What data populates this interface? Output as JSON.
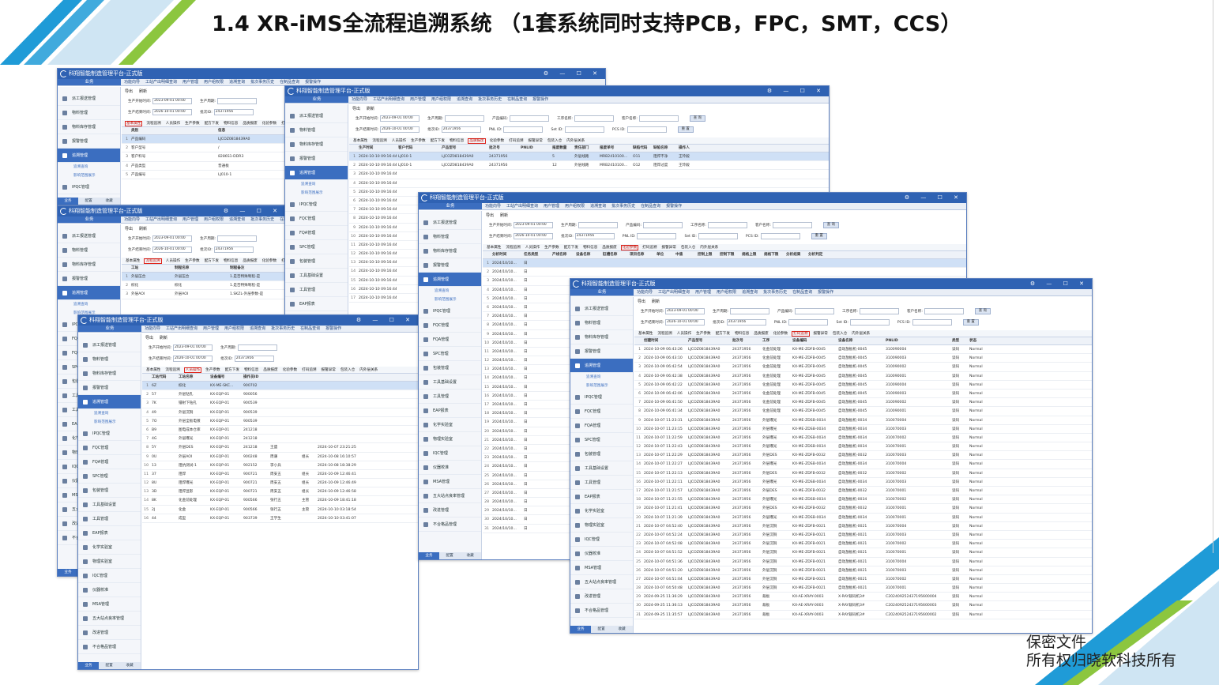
{
  "slide": {
    "title": "1.4 XR-iMS全流程追溯系统 （1套系统同时支持PCB，FPC，SMT，CCS）",
    "watermark_line1": "保密文件",
    "watermark_line2": "所有权归晓软科技所有"
  },
  "colors": {
    "accent": "#2f62b3",
    "highlight": "#e0241a",
    "deco_blue": "#1f9bd7",
    "deco_green": "#8cc63f"
  },
  "app": {
    "window_title": "科翔智能制造管理平台-正式版",
    "biz_label": "业务",
    "window_controls": "⚙ — ☐ ✕",
    "toolbar_export": "导出",
    "toolbar_refresh": "刷新",
    "top_tabs_a": [
      "功能向导",
      "工站产出明细查询",
      "用户管理",
      "用户组权限",
      "追溯查询",
      "批次事务历史",
      "在制品查询",
      "报警操作"
    ],
    "sidebar_items": [
      "派工报送管理",
      "物料管理",
      "物料库存管理",
      "报警管理",
      "追溯管理",
      "IPQC管理",
      "FQC管理",
      "FQA管理",
      "SPC管理",
      "包装管理",
      "工具基础设置",
      "工具管理",
      "EAP报表",
      "化学实验室",
      "物理实验室",
      "IQC管理",
      "仪器校准",
      "MSA管理",
      "五大站点良率管理",
      "改进管理",
      "不合格品管理"
    ],
    "sidebar_sub": [
      "追溯查询",
      "影响范围展示"
    ],
    "sidebar_foot": [
      "业务",
      "配置",
      "收藏"
    ],
    "filters": {
      "start_label": "生产开始时间:",
      "start_value": "2023-09-01 00:00",
      "end_label": "生产结束时间:",
      "end_value": "2026-10-01 00:00",
      "cycle_label": "生产周期:",
      "batch_label": "批次ID:",
      "batch_value": "24371956",
      "product_label": "产品编码:",
      "pnl_label": "PNL ID:",
      "proc_label": "工序名称:",
      "set_label": "Set ID:",
      "customer_label": "客户名称:",
      "pcs_label": "PCS ID:",
      "query_btn": "查 询",
      "reset_btn": "重 置"
    },
    "subtabs": [
      "基本属性",
      "流程追溯",
      "人员操作",
      "生产参数",
      "配方下发",
      "物料信息",
      "品质报废",
      "化验参数",
      "打码追溯",
      "报警异常",
      "包装入仓",
      "内外层关系"
    ]
  },
  "windows": {
    "w1": {
      "highlight": "基本属性",
      "headers": [
        "类别",
        "信息"
      ],
      "rows": [
        [
          "产品编码",
          "LJCOZ0818439A0"
        ],
        [
          "客户型号",
          "/"
        ],
        [
          "客户料号",
          "8286S1-DDR3"
        ],
        [
          "产品类型",
          "普通板"
        ],
        [
          "产品编号",
          "LJ010-1"
        ]
      ]
    },
    "w2": {
      "highlight": "流程追溯",
      "headers": [
        "工站",
        "制程名称",
        "制程备注"
      ],
      "rows": [
        [
          "外层压合",
          "外层压合",
          "1.是否特殊制程-是"
        ],
        [
          "棕化",
          "棕化",
          "1.是否特殊制程-是"
        ],
        [
          "外层AOI",
          "外层AOI",
          "1.SKZL-外层参数-是"
        ]
      ]
    },
    "w3": {
      "highlight": "人员操作",
      "headers": [
        "工站代码",
        "工站名称",
        "设备编号",
        "操作员ID"
      ],
      "rows": [
        [
          "6Z",
          "棕化",
          "KX-ME-SKC...",
          "900702"
        ],
        [
          "57",
          "外层钻孔",
          "KX-EQP-01",
          "900056"
        ],
        [
          "7K",
          "镭射下钻孔",
          "KX-EQP-01",
          "900539"
        ],
        [
          "49",
          "外层沉铜",
          "KX-EQP-01",
          "900539"
        ],
        [
          "7O",
          "外层全板电镀",
          "KX-EQP-01",
          "900539"
        ],
        [
          "B9",
          "图电成本仓库",
          "KX-EQP-01",
          "241218"
        ],
        [
          "4G",
          "外层曝光",
          "KX-EQP-01",
          "241218"
        ],
        [
          "5Y",
          "外层DES",
          "KX-EQP-01",
          "241218"
        ],
        [
          "0U",
          "外层AOI",
          "KX-EQP-01",
          "900248"
        ],
        [
          "13",
          "阻抗测试-1",
          "KX-EQP-01",
          "902152"
        ],
        [
          "37",
          "阻焊",
          "KX-EQP-01",
          "900721"
        ],
        [
          "8U",
          "阻焊曝光",
          "KX-EQP-01",
          "900721"
        ],
        [
          "3D",
          "阻焊显影",
          "KX-EQP-01",
          "900721"
        ],
        [
          "8K",
          "化金前处理",
          "KX-EQP-01",
          "900566"
        ],
        [
          "2J",
          "化金",
          "KX-EQP-01",
          "900566"
        ],
        [
          "44",
          "成型",
          "KX-EQP-01",
          "903739"
        ]
      ],
      "extra_rows": [
        [
          "王盛",
          "",
          "2024-10-07 23:21:25"
        ],
        [
          "周谦",
          "组长",
          "2024-10-08 16:10:57"
        ],
        [
          "李小兵",
          "",
          "2024-10-08 18:38:29"
        ],
        [
          "周安五",
          "组长",
          "2024-10-09 12:46:41"
        ],
        [
          "周安五",
          "组长",
          "2024-10-09 12:46:49"
        ],
        [
          "周安五",
          "组长",
          "2024-10-09 12:46:58"
        ],
        [
          "张行五",
          "主管",
          "2024-10-09 18:41:18"
        ],
        [
          "张行五",
          "主管",
          "2024-10-10 03:18:54"
        ],
        [
          "王学生",
          "",
          "2024-10-10 03:41:07"
        ]
      ]
    },
    "w4": {
      "highlight": "品质报废",
      "headers": [
        "生产时间",
        "客户代码",
        "产品型号",
        "批次号",
        "PNLID",
        "报废数量",
        "责任部门",
        "报废单号",
        "缺陷代码",
        "缺陷名称",
        "操作人"
      ],
      "rows": [
        [
          "2024-10-10 09:16:44",
          "LJ010-1",
          "LJCOZ0818439A0",
          "24371956",
          "",
          "5",
          "外层线路",
          "MRB2410100...",
          "O11",
          "阻焊不净",
          "王玲毅"
        ],
        [
          "2024-10-10 09:16:44",
          "LJ010-1",
          "LJCOZ0818439A0",
          "24371956",
          "",
          "12",
          "外层线路",
          "MRB2410100...",
          "O12",
          "阻焊过度",
          "王玲毅"
        ]
      ],
      "time_rows": 17,
      "time_value": "2024-10-10 09:16:44"
    },
    "w5": {
      "highlight": "化验参数",
      "headers": [
        "分析时间",
        "任务类型",
        "产线名称",
        "设备名称",
        "缸槽名称",
        "项目名称",
        "单位",
        "中值",
        "控制上限",
        "控制下限",
        "规格上限",
        "规格下限",
        "分析结果",
        "分析判定"
      ],
      "time_value": "2024/10/10...",
      "type_value": "日",
      "rows": 31
    },
    "w6": {
      "highlight": "打码追溯",
      "headers": [
        "创建时间",
        "产品型号",
        "批次号",
        "工序",
        "设备编码",
        "设备名称",
        "PNLID",
        "类型",
        "状态"
      ],
      "rows": [
        [
          "2024-10-09 06:43:26",
          "LJCOZ0818439A0",
          "24371956",
          "化金前处理",
          "KX-ME-ZDFB-0045",
          "自动放板机-0045",
          "310090004",
          "读码",
          "Normal"
        ],
        [
          "2024-10-09 06:43:10",
          "LJCOZ0818439A0",
          "24371956",
          "化金前处理",
          "KX-ME-ZDFB-0045",
          "自动放板机-0045",
          "310090003",
          "读码",
          "Normal"
        ],
        [
          "2024-10-09 06:42:54",
          "LJCOZ0818439A0",
          "24371956",
          "化金前处理",
          "KX-ME-ZDFB-0045",
          "自动放板机-0045",
          "310090002",
          "读码",
          "Normal"
        ],
        [
          "2024-10-09 06:42:38",
          "LJCOZ0818439A0",
          "24371956",
          "化金前处理",
          "KX-ME-ZDFB-0045",
          "自动放板机-0045",
          "310090001",
          "读码",
          "Normal"
        ],
        [
          "2024-10-09 06:42:22",
          "LJCOZ0818439A0",
          "24371956",
          "化金前处理",
          "KX-ME-ZDFB-0045",
          "自动放板机-0045",
          "310090004",
          "读码",
          "Normal"
        ],
        [
          "2024-10-09 06:42:06",
          "LJCOZ0818439A0",
          "24371956",
          "化金前处理",
          "KX-ME-ZDFB-0045",
          "自动放板机-0045",
          "310090003",
          "读码",
          "Normal"
        ],
        [
          "2024-10-09 06:41:50",
          "LJCOZ0818439A0",
          "24371956",
          "化金前处理",
          "KX-ME-ZDFB-0045",
          "自动放板机-0045",
          "310090002",
          "读码",
          "Normal"
        ],
        [
          "2024-10-09 06:41:34",
          "LJCOZ0818439A0",
          "24371956",
          "化金前处理",
          "KX-ME-ZDFB-0045",
          "自动放板机-0045",
          "310090001",
          "读码",
          "Normal"
        ],
        [
          "2024-10-07 11:23:31",
          "LJCOZ0818439A0",
          "24371956",
          "外层曝光",
          "KX-ME-ZDSB-0034",
          "自动放板机-0034",
          "310070004",
          "读码",
          "Normal"
        ],
        [
          "2024-10-07 11:23:15",
          "LJCOZ0818439A0",
          "24371956",
          "外层曝光",
          "KX-ME-ZDSB-0034",
          "自动放板机-0034",
          "310070003",
          "读码",
          "Normal"
        ],
        [
          "2024-10-07 11:22:59",
          "LJCOZ0818439A0",
          "24371956",
          "外层曝光",
          "KX-ME-ZDSB-0034",
          "自动放板机-0034",
          "310070002",
          "读码",
          "Normal"
        ],
        [
          "2024-10-07 11:22:43",
          "LJCOZ0818439A0",
          "24371956",
          "外层曝光",
          "KX-ME-ZDSB-0034",
          "自动放板机-0034",
          "310070001",
          "读码",
          "Normal"
        ],
        [
          "2024-10-07 11:22:29",
          "LJCOZ0818439A0",
          "24371956",
          "外层DES",
          "KX-ME-ZDFB-0032",
          "自动放板机-0032",
          "310070003",
          "读码",
          "Normal"
        ],
        [
          "2024-10-07 11:22:27",
          "LJCOZ0818439A0",
          "24371956",
          "外层曝光",
          "KX-ME-ZDSB-0034",
          "自动放板机-0034",
          "310070004",
          "读码",
          "Normal"
        ],
        [
          "2024-10-07 11:22:13",
          "LJCOZ0818439A0",
          "24371956",
          "外层DES",
          "KX-ME-ZDFB-0032",
          "自动放板机-0032",
          "310070002",
          "读码",
          "Normal"
        ],
        [
          "2024-10-07 11:22:11",
          "LJCOZ0818439A0",
          "24371956",
          "外层曝光",
          "KX-ME-ZDSB-0034",
          "自动放板机-0034",
          "310070003",
          "读码",
          "Normal"
        ],
        [
          "2024-10-07 11:21:57",
          "LJCOZ0818439A0",
          "24371956",
          "外层DES",
          "KX-ME-ZDFB-0032",
          "自动放板机-0032",
          "310070001",
          "读码",
          "Normal"
        ],
        [
          "2024-10-07 11:21:55",
          "LJCOZ0818439A0",
          "24371956",
          "外层曝光",
          "KX-ME-ZDSB-0034",
          "自动放板机-0034",
          "310070002",
          "读码",
          "Normal"
        ],
        [
          "2024-10-07 11:21:41",
          "LJCOZ0818439A0",
          "24371956",
          "外层DES",
          "KX-ME-ZDFB-0032",
          "自动放板机-0032",
          "310070001",
          "读码",
          "Normal"
        ],
        [
          "2024-10-07 11:21:39",
          "LJCOZ0818439A0",
          "24371956",
          "外层曝光",
          "KX-ME-ZDSB-0034",
          "自动放板机-0034",
          "310070001",
          "读码",
          "Normal"
        ],
        [
          "2024-10-07 04:52:40",
          "LJCOZ0818439A0",
          "24371956",
          "外层沉铜",
          "KX-ME-ZDFB-0021",
          "自动放板机-0021",
          "310070004",
          "读码",
          "Normal"
        ],
        [
          "2024-10-07 04:52:24",
          "LJCOZ0818439A0",
          "24371956",
          "外层沉铜",
          "KX-ME-ZDFB-0021",
          "自动放板机-0021",
          "310070003",
          "读码",
          "Normal"
        ],
        [
          "2024-10-07 04:52:08",
          "LJCOZ0818439A0",
          "24371956",
          "外层沉铜",
          "KX-ME-ZDFB-0021",
          "自动放板机-0021",
          "310070002",
          "读码",
          "Normal"
        ],
        [
          "2024-10-07 04:51:52",
          "LJCOZ0818439A0",
          "24371956",
          "外层沉铜",
          "KX-ME-ZDFB-0021",
          "自动放板机-0021",
          "310070001",
          "读码",
          "Normal"
        ],
        [
          "2024-10-07 04:51:36",
          "LJCOZ0818439A0",
          "24371956",
          "外层沉铜",
          "KX-ME-ZDFB-0021",
          "自动放板机-0021",
          "310070004",
          "读码",
          "Normal"
        ],
        [
          "2024-10-07 04:51:20",
          "LJCOZ0818439A0",
          "24371956",
          "外层沉铜",
          "KX-ME-ZDFB-0021",
          "自动放板机-0021",
          "310070003",
          "读码",
          "Normal"
        ],
        [
          "2024-10-07 04:51:04",
          "LJCOZ0818439A0",
          "24371956",
          "外层沉铜",
          "KX-ME-ZDFB-0021",
          "自动放板机-0021",
          "310070002",
          "读码",
          "Normal"
        ],
        [
          "2024-10-07 04:50:48",
          "LJCOZ0818439A0",
          "24371956",
          "外层沉铜",
          "KX-ME-ZDFB-0021",
          "自动放板机-0021",
          "310070001",
          "读码",
          "Normal"
        ],
        [
          "2024-09-25 11:36:29",
          "LJCOZ0818439A0",
          "24371956",
          "裁板",
          "KX-AE-XRAY-0003",
          "X-RAY裁码机3#",
          "C202409252437195600004",
          "读码",
          "Normal"
        ],
        [
          "2024-09-25 11:36:13",
          "LJCOZ0818439A0",
          "24371956",
          "裁板",
          "KX-AE-XRAY-0003",
          "X-RAY裁码机3#",
          "C202409252437195600003",
          "读码",
          "Normal"
        ],
        [
          "2024-09-25 11:35:57",
          "LJCOZ0818439A0",
          "24371956",
          "裁板",
          "KX-AE-XRAY-0003",
          "X-RAY裁码机3#",
          "C202409252437195600002",
          "读码",
          "Normal"
        ]
      ]
    }
  }
}
